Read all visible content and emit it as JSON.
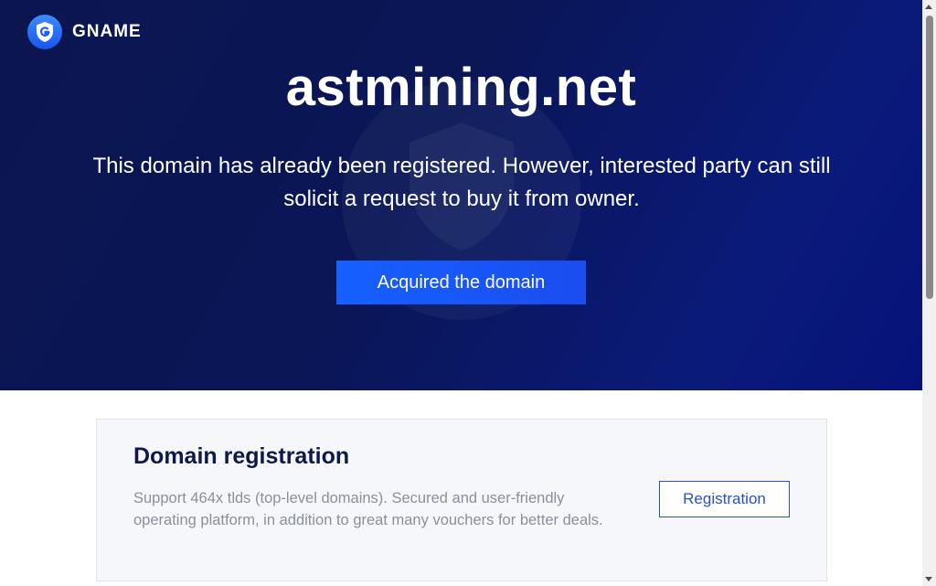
{
  "brand": {
    "name": "GNAME",
    "logo_icon": "gname-shield-logo"
  },
  "hero": {
    "domain": "astmining.net",
    "description": "This domain has already been registered. However, interested party can still solicit a request to buy it from owner.",
    "acquire_button": "Acquired the domain"
  },
  "card": {
    "title": "Domain registration",
    "description": "Support 464x tlds (top-level domains). Secured and user-friendly operating platform, in addition to great many vouchers for better deals.",
    "button": "Registration"
  },
  "colors": {
    "hero_bg": "#0a1656",
    "accent": "#1560ff",
    "card_bg": "#f6f7fb",
    "link": "#2a50c8"
  }
}
